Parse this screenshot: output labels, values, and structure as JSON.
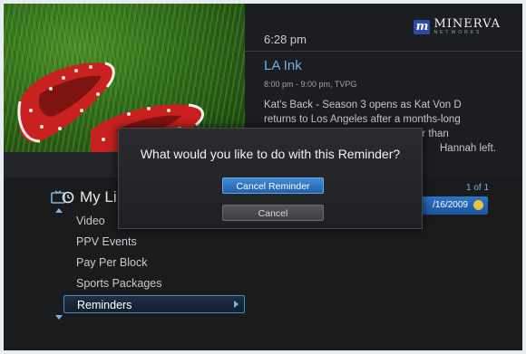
{
  "header": {
    "clock": "6:28 pm",
    "logo": {
      "name": "MINERVA",
      "sub": "NETWORKS",
      "mark": "m"
    }
  },
  "program": {
    "title": "LA Ink",
    "time": "8:00 pm - 9:00 pm, TVPG",
    "description_lines": [
      "Kat's Back - Season 3 opens as Kat Von D",
      "returns to Los Angeles after a months-long",
      "er than",
      "Hannah left."
    ]
  },
  "list": {
    "title": "My Li",
    "items": [
      {
        "label": "Video"
      },
      {
        "label": "PPV Events"
      },
      {
        "label": "Pay Per Block"
      },
      {
        "label": "Sports Packages"
      },
      {
        "label": "Reminders"
      }
    ],
    "selected_index": 4
  },
  "reminders": {
    "page_count": "1 of 1",
    "entry_date": "/16/2009"
  },
  "dialog": {
    "question": "What would you like to do with this Reminder?",
    "primary_label": "Cancel Reminder",
    "secondary_label": "Cancel"
  },
  "colors": {
    "accent": "#6cb2ea",
    "primary_button": "#2f73c4",
    "background": "#1a1b1d"
  }
}
